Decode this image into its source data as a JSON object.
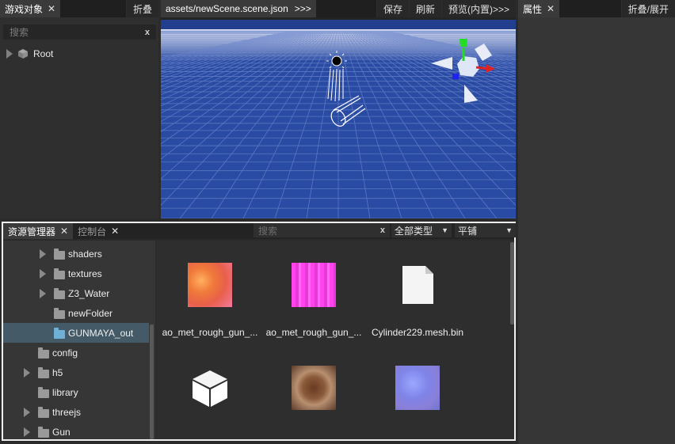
{
  "hierarchy": {
    "tab_label": "游戏对象",
    "collapse_label": "折叠",
    "search_placeholder": "搜索",
    "search_clear": "x",
    "root_label": "Root"
  },
  "scene": {
    "tab_label": "assets/newScene.scene.json",
    "tab_more": ">>>",
    "save_label": "保存",
    "refresh_label": "刷新",
    "preview_label": "预览(内置)>>>",
    "sky_color": "#1f3b88",
    "ground_color": "#2d4fa6",
    "gizmo_colors": {
      "y_axis": "#22dd22",
      "x_axis": "#dd2222",
      "z_axis": "#2222ee"
    }
  },
  "properties": {
    "tab_label": "属性",
    "collapse_expand_label": "折叠/展开"
  },
  "assets": {
    "tab_label": "资源管理器",
    "console_tab_label": "控制台",
    "search_placeholder": "搜索",
    "search_clear": "x",
    "type_filter": "全部类型",
    "view_mode": "平铺",
    "folders": [
      {
        "label": "shaders",
        "expandable": true
      },
      {
        "label": "textures",
        "expandable": true
      },
      {
        "label": "Z3_Water",
        "expandable": true
      },
      {
        "label": "newFolder",
        "expandable": false
      },
      {
        "label": "GUNMAYA_out",
        "expandable": false,
        "selected": true
      },
      {
        "label": "config",
        "expandable": false
      },
      {
        "label": "h5",
        "expandable": true
      },
      {
        "label": "library",
        "expandable": false
      },
      {
        "label": "threejs",
        "expandable": true
      },
      {
        "label": "Gun",
        "expandable": true
      }
    ],
    "items": [
      {
        "label": "ao_met_rough_gun_...",
        "icon": "orange-texture-icon"
      },
      {
        "label": "ao_met_rough_gun_...",
        "icon": "magenta-texture-icon"
      },
      {
        "label": "Cylinder229.mesh.bin",
        "icon": "file-icon"
      },
      {
        "label": "",
        "icon": "cube-prefab-icon"
      },
      {
        "label": "",
        "icon": "brown-texture-icon"
      },
      {
        "label": "",
        "icon": "normal-map-icon"
      }
    ]
  }
}
